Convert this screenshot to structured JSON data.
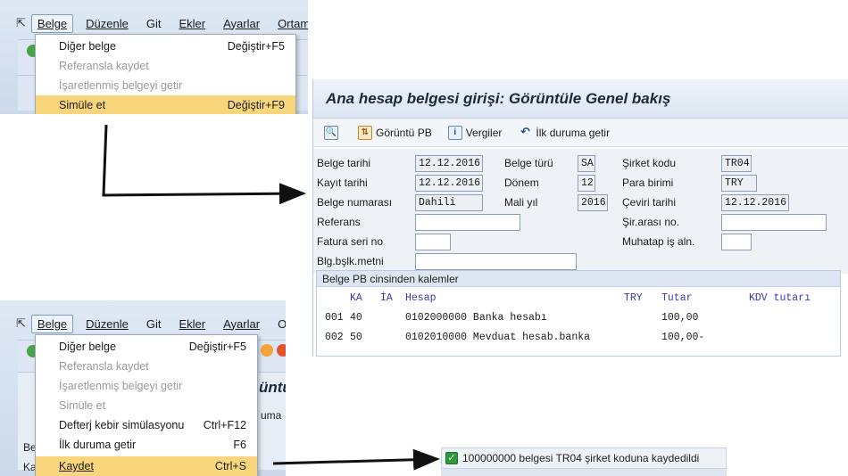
{
  "top_menu": {
    "menubar": [
      "Belge",
      "Düzenle",
      "Git",
      "Ekler",
      "Ayarlar",
      "Ortam"
    ],
    "items": [
      {
        "label": "Diğer belge",
        "shortcut": "Değiştir+F5"
      },
      {
        "label": "Referansla kaydet",
        "shortcut": ""
      },
      {
        "label": "İşaretlenmiş belgeyi getir",
        "shortcut": ""
      },
      {
        "label": "Simüle et",
        "shortcut": "Değiştir+F9"
      }
    ]
  },
  "bottom_menu": {
    "menubar": [
      "Belge",
      "Düzenle",
      "Git",
      "Ekler",
      "Ayarlar",
      "Or"
    ],
    "items": [
      {
        "label": "Diğer belge",
        "shortcut": "Değiştir+F5"
      },
      {
        "label": "Referansla kaydet",
        "shortcut": ""
      },
      {
        "label": "İşaretlenmiş belgeyi getir",
        "shortcut": ""
      },
      {
        "label": "Simüle et",
        "shortcut": ""
      },
      {
        "label": "Defterj kebir simülasyonu",
        "shortcut": "Ctrl+F12"
      },
      {
        "label": "İlk duruma getir",
        "shortcut": "F6"
      },
      {
        "label": "Kaydet",
        "shortcut": "Ctrl+S"
      }
    ],
    "behind_fragment_1": "üntü",
    "behind_fragment_2": "uma",
    "behind_fragment_3": "Be",
    "behind_fragment_4": "Ka"
  },
  "window": {
    "title": "Ana hesap belgesi girişi: Görüntüle Genel bakış",
    "toolbar": {
      "display_pb": "Görüntü PB",
      "taxes": "Vergiler",
      "reset": "İlk duruma getir"
    },
    "form": {
      "belge_tarihi": {
        "label": "Belge tarihi",
        "value": "12.12.2016"
      },
      "kayit_tarihi": {
        "label": "Kayıt tarihi",
        "value": "12.12.2016"
      },
      "belge_numarasi": {
        "label": "Belge numarası",
        "value": "Dahili"
      },
      "referans": {
        "label": "Referans",
        "value": ""
      },
      "fatura_seri_no": {
        "label": "Fatura seri no",
        "value": ""
      },
      "blg_bslk_metni": {
        "label": "Blg.bşlk.metni",
        "value": ""
      },
      "belge_turu": {
        "label": "Belge türü",
        "value": "SA"
      },
      "donem": {
        "label": "Dönem",
        "value": "12"
      },
      "mali_yil": {
        "label": "Mali yıl",
        "value": "2016"
      },
      "sirket_kodu": {
        "label": "Şirket kodu",
        "value": "TR04"
      },
      "para_birimi": {
        "label": "Para birimi",
        "value": "TRY"
      },
      "ceviri_tarihi": {
        "label": "Çeviri tarihi",
        "value": "12.12.2016"
      },
      "sir_arasi_no": {
        "label": "Şir.arası no.",
        "value": ""
      },
      "muhatap_is_aln": {
        "label": "Muhatap iş aln.",
        "value": ""
      }
    },
    "items": {
      "header": "Belge PB cinsinden kalemler",
      "columns": {
        "ka": "KA",
        "ia": "İA",
        "hesap": "Hesap",
        "currency": "TRY",
        "tutar": "Tutar",
        "kdv": "KDV tutarı"
      },
      "rows": [
        {
          "no": "001",
          "ka": "40",
          "hesap": "0102000000 Banka hesabı",
          "tutar": "100,00"
        },
        {
          "no": "002",
          "ka": "50",
          "hesap": "0102010000 Mevduat hesab.banka",
          "tutar": "100,00-"
        }
      ]
    }
  },
  "status_bar": {
    "message": "100000000 belgesi TR04 şirket koduna kaydedildi"
  },
  "colors": {
    "highlight": "#f9d67c",
    "sap_blue": "#dde6f2",
    "success": "#2e9b3a",
    "arrow": "#111111"
  }
}
